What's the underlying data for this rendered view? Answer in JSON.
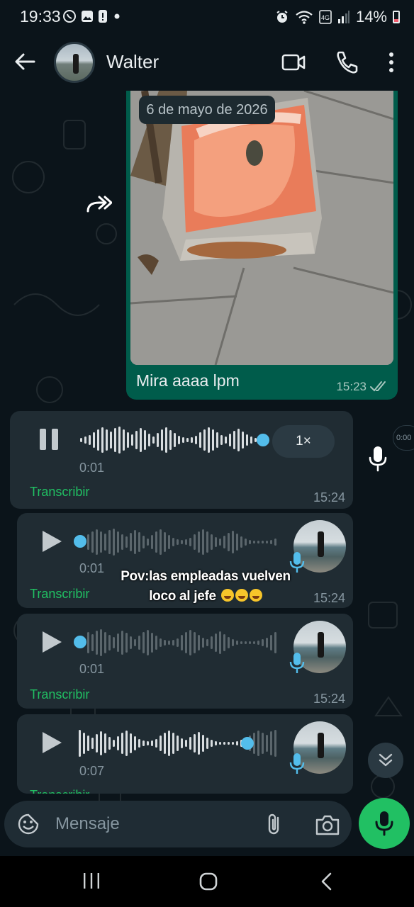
{
  "status_bar": {
    "time": "19:33",
    "battery": "14%"
  },
  "header": {
    "contact_name": "Walter"
  },
  "date_chip": "6 de mayo de 2026",
  "image_message": {
    "caption": "Mira aaaa lpm",
    "time": "15:23"
  },
  "voice_messages": [
    {
      "duration": "0:01",
      "time": "15:24",
      "transcribe_label": "Transcribir",
      "speed": "1×",
      "playing": true,
      "progress": 1.0
    },
    {
      "duration": "0:01",
      "time": "15:24",
      "transcribe_label": "Transcribir",
      "playing": false,
      "progress": 0.0
    },
    {
      "duration": "0:01",
      "time": "15:24",
      "transcribe_label": "Transcribir",
      "playing": false,
      "progress": 0.0
    },
    {
      "duration": "0:07",
      "time": "",
      "transcribe_label": "Transcribir",
      "playing": false,
      "progress": 0.85
    }
  ],
  "overlay_caption": {
    "line1": "Pov:las empleadas vuelven",
    "line2": "loco al jefe"
  },
  "side_chip": "0:00",
  "input": {
    "placeholder": "Mensaje"
  },
  "colors": {
    "accent": "#21c063",
    "outgoing_bubble": "#005c4b",
    "incoming_bubble": "#202c33",
    "background": "#0b141a",
    "played_dot": "#53bdeb"
  },
  "icons": [
    "whatsapp-icon",
    "gallery-icon",
    "alert-icon",
    "alarm-icon",
    "wifi-icon",
    "volte-icon",
    "signal-icon",
    "battery-icon",
    "back-arrow-icon",
    "video-call-icon",
    "phone-icon",
    "more-options-icon",
    "forward-icon",
    "play-icon",
    "pause-icon",
    "mic-icon",
    "chevron-double-down-icon",
    "emoji-icon",
    "attach-icon",
    "camera-icon",
    "recents-icon",
    "home-icon",
    "nav-back-icon"
  ]
}
